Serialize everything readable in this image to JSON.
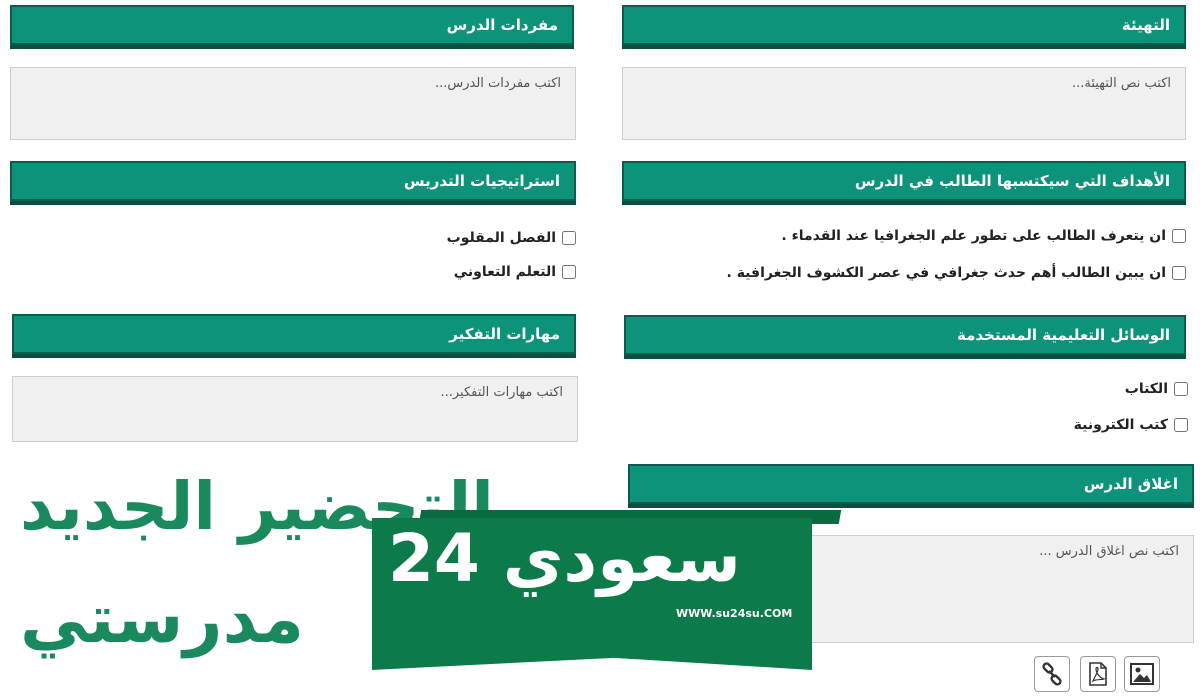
{
  "sections": {
    "warmup": {
      "title": "التهيئة",
      "placeholder": "اكتب نص التهيئة..."
    },
    "vocab": {
      "title": "مفردات الدرس",
      "placeholder": "اكتب مفردات الدرس..."
    },
    "objectives": {
      "title": "الأهداف التي سيكتسبها الطالب في الدرس",
      "items": [
        "ان يتعرف الطالب على تطور علم الجغرافيا عند القدماء .",
        "ان يبين الطالب أهم حدث جغرافي في عصر الكشوف الجغرافية ."
      ]
    },
    "strategies": {
      "title": "استراتيجيات التدريس",
      "items": [
        "الفصل المقلوب",
        "التعلم التعاوني"
      ]
    },
    "aids": {
      "title": "الوسائل التعليمية المستخدمة",
      "items": [
        "الكتاب",
        "كتب الكترونية"
      ]
    },
    "thinking": {
      "title": "مهارات التفكير",
      "placeholder": "اكتب مهارات التفكير..."
    },
    "closing": {
      "title": "اغلاق الدرس",
      "placeholder": "اكتب نص اغلاق الدرس ..."
    }
  },
  "toolbar": {
    "icons": [
      "image-icon",
      "pdf-icon",
      "link-icon"
    ]
  },
  "watermark": {
    "line1": "التحضير الجديد",
    "line2": "مدرستي",
    "brand": "سعودي 24",
    "url": "WWW.su24su.COM"
  },
  "colors": {
    "header_bg": "#0c9379",
    "header_border": "#0a5c4d",
    "watermark": "#1a8a5e",
    "banner": "#0d7a4a"
  }
}
